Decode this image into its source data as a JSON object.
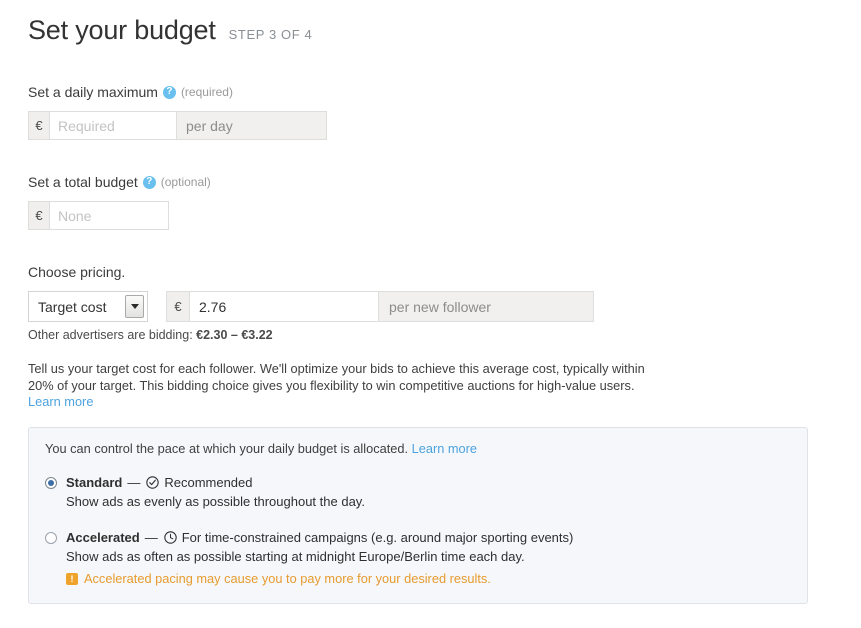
{
  "header": {
    "title": "Set your budget",
    "step": "STEP 3 OF 4"
  },
  "daily_maximum": {
    "label": "Set a daily maximum",
    "help_icon": "question-mark-icon",
    "requirement": "(required)",
    "currency_symbol": "€",
    "value": "",
    "placeholder": "Required",
    "suffix": "per day"
  },
  "total_budget": {
    "label": "Set a total budget",
    "help_icon": "question-mark-icon",
    "requirement": "(optional)",
    "currency_symbol": "€",
    "value": "",
    "placeholder": "None"
  },
  "pricing": {
    "label": "Choose pricing.",
    "select_value": "Target cost",
    "select_options": [
      "Target cost"
    ],
    "currency_symbol": "€",
    "bid_value": "2.76",
    "bid_suffix": "per new follower",
    "bid_hint_prefix": "Other advertisers are bidding: ",
    "bid_hint_range": "€2.30 – €3.22",
    "description": "Tell us your target cost for each follower. We'll optimize your bids to achieve this average cost, typically within 20% of your target. This bidding choice gives you flexibility to win competitive auctions for high-value users. ",
    "description_link": "Learn more"
  },
  "pacing": {
    "intro": "You can control the pace at which your daily budget is allocated. ",
    "intro_link": "Learn more",
    "options": [
      {
        "name": "Standard",
        "dash": "—",
        "icon": "check-circle-icon",
        "tagline": "Recommended",
        "description": "Show ads as evenly as possible throughout the day.",
        "selected": true
      },
      {
        "name": "Accelerated",
        "dash": "—",
        "icon": "clock-icon",
        "tagline": "For time-constrained campaigns (e.g. around major sporting events)",
        "description": "Show ads as often as possible starting at midnight Europe/Berlin time each day.",
        "warning_icon": "warning-exclamation-icon",
        "warning": "Accelerated pacing may cause you to pay more for your desired results.",
        "selected": false
      }
    ]
  },
  "colors": {
    "help_blue": "#69c0ef",
    "link_blue": "#4ca3e0",
    "warning_orange": "#e79b2f",
    "radio_blue": "#3c6ea5",
    "panel_bg": "#f5f7fa"
  }
}
